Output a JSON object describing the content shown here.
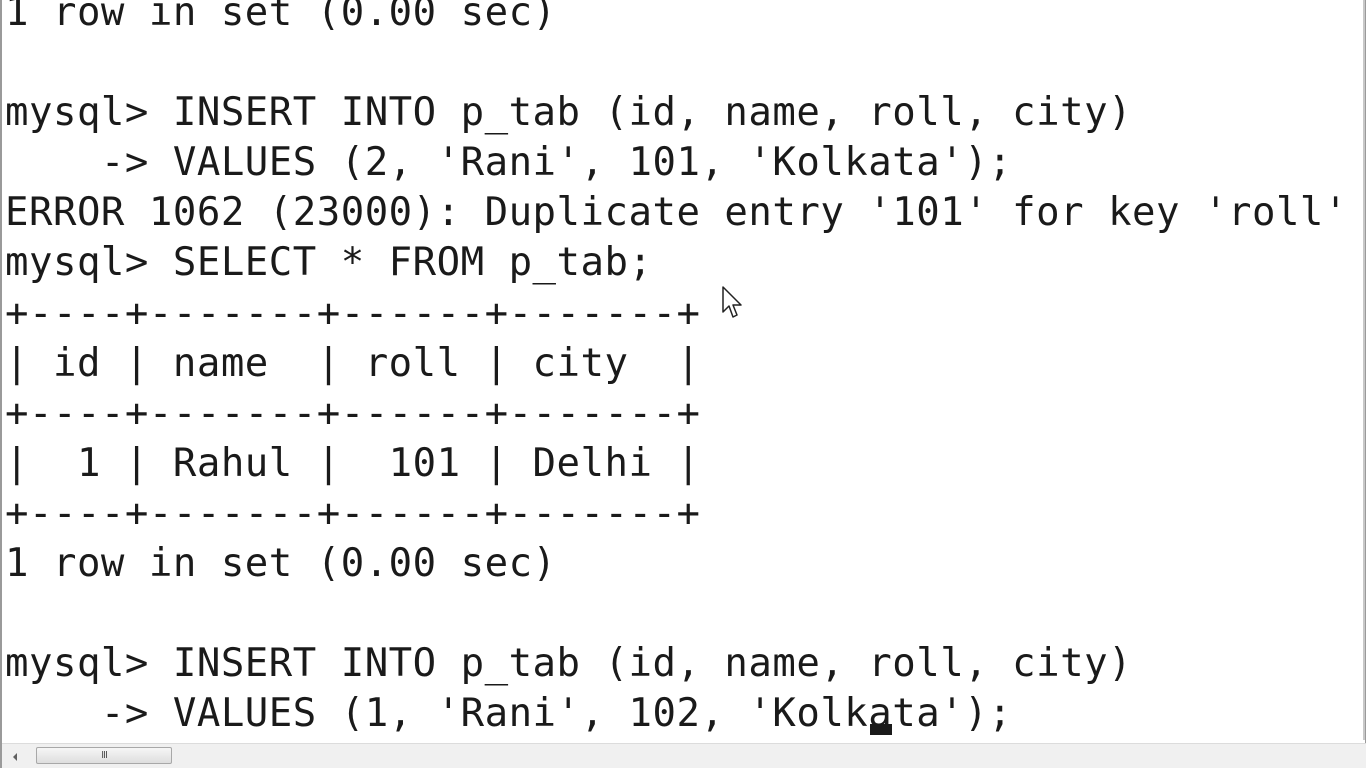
{
  "console": {
    "lines": [
      "1 row in set (0.00 sec)",
      "",
      "mysql> INSERT INTO p_tab (id, name, roll, city)",
      "    -> VALUES (2, 'Rani', 101, 'Kolkata');",
      "ERROR 1062 (23000): Duplicate entry '101' for key 'roll'",
      "mysql> SELECT * FROM p_tab;",
      "+----+-------+------+-------+",
      "| id | name  | roll | city  |",
      "+----+-------+------+-------+",
      "|  1 | Rahul |  101 | Delhi |",
      "+----+-------+------+-------+",
      "1 row in set (0.00 sec)",
      "",
      "mysql> INSERT INTO p_tab (id, name, roll, city)",
      "    -> VALUES (1, 'Rani', 102, 'Kolkata');"
    ]
  },
  "scrollbar": {
    "grip": "III",
    "left_arrow_icon": "triangle-left-icon"
  }
}
